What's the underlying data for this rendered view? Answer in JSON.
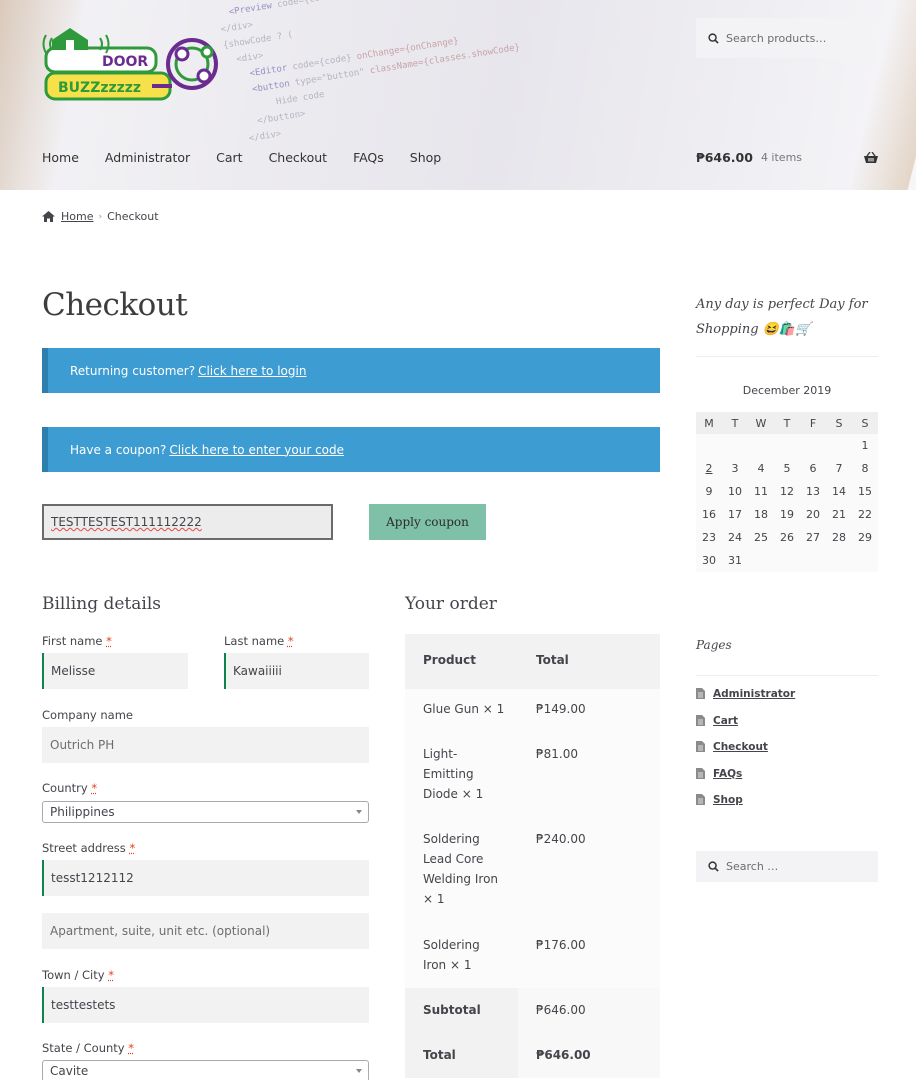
{
  "header": {
    "logo_alt": "DOOR BUZZzzzzz",
    "logo_word1": "DOOR",
    "logo_word2": "BUZZzzzzz",
    "search_placeholder": "Search products…",
    "nav": [
      "Home",
      "Administrator",
      "Cart",
      "Checkout",
      "FAQs",
      "Shop"
    ],
    "cart_amount": "₱646.00",
    "cart_count": "4 items"
  },
  "breadcrumb": {
    "home": "Home",
    "current": "Checkout"
  },
  "page": {
    "title": "Checkout",
    "login_notice": "Returning customer?",
    "login_link": "Click here to login",
    "coupon_notice": "Have a coupon?",
    "coupon_link": "Click here to enter your code",
    "coupon_value": "TESTTESTEST111112222",
    "apply_coupon": "Apply coupon"
  },
  "billing": {
    "heading": "Billing details",
    "required_mark": "*",
    "first_name_label": "First name",
    "first_name": "Melisse",
    "last_name_label": "Last name",
    "last_name": "Kawaiiiii",
    "company_label": "Company name",
    "company": "Outrich PH",
    "country_label": "Country",
    "country": "Philippines",
    "street_label": "Street address",
    "street": "tesst1212112",
    "apartment_placeholder": "Apartment, suite, unit etc. (optional)",
    "town_label": "Town / City",
    "town": "testtestets",
    "state_label": "State / County",
    "state": "Cavite"
  },
  "order": {
    "heading": "Your order",
    "col_product": "Product",
    "col_total": "Total",
    "items": [
      {
        "name": "Glue Gun",
        "qty": "× 1",
        "total": "₱149.00"
      },
      {
        "name": "Light-Emitting Diode",
        "qty": "× 1",
        "total": "₱81.00"
      },
      {
        "name": "Soldering Lead Core Welding Iron",
        "qty": "× 1",
        "total": "₱240.00"
      },
      {
        "name": "Soldering Iron",
        "qty": "× 1",
        "total": "₱176.00"
      }
    ],
    "subtotal_label": "Subtotal",
    "subtotal": "₱646.00",
    "total_label": "Total",
    "total": "₱646.00"
  },
  "sidebar": {
    "tagline": "Any day is perfect Day for Shopping 😆🛍️🛒",
    "calendar_caption": "December 2019",
    "calendar_days": [
      "M",
      "T",
      "W",
      "T",
      "F",
      "S",
      "S"
    ],
    "calendar_weeks": [
      [
        "",
        "",
        "",
        "",
        "",
        "",
        "1"
      ],
      [
        "2",
        "3",
        "4",
        "5",
        "6",
        "7",
        "8"
      ],
      [
        "9",
        "10",
        "11",
        "12",
        "13",
        "14",
        "15"
      ],
      [
        "16",
        "17",
        "18",
        "19",
        "20",
        "21",
        "22"
      ],
      [
        "23",
        "24",
        "25",
        "26",
        "27",
        "28",
        "29"
      ],
      [
        "30",
        "31",
        "",
        "",
        "",
        "",
        ""
      ]
    ],
    "calendar_linked_day": "2",
    "pages_heading": "Pages",
    "pages": [
      "Administrator",
      "Cart",
      "Checkout",
      "FAQs",
      "Shop"
    ],
    "search_placeholder": "Search …"
  },
  "colors": {
    "notice_blue": "#3d9cd2",
    "button_green": "#7fc0a9",
    "field_accent": "#0f834d",
    "required_red": "#e2401c"
  }
}
